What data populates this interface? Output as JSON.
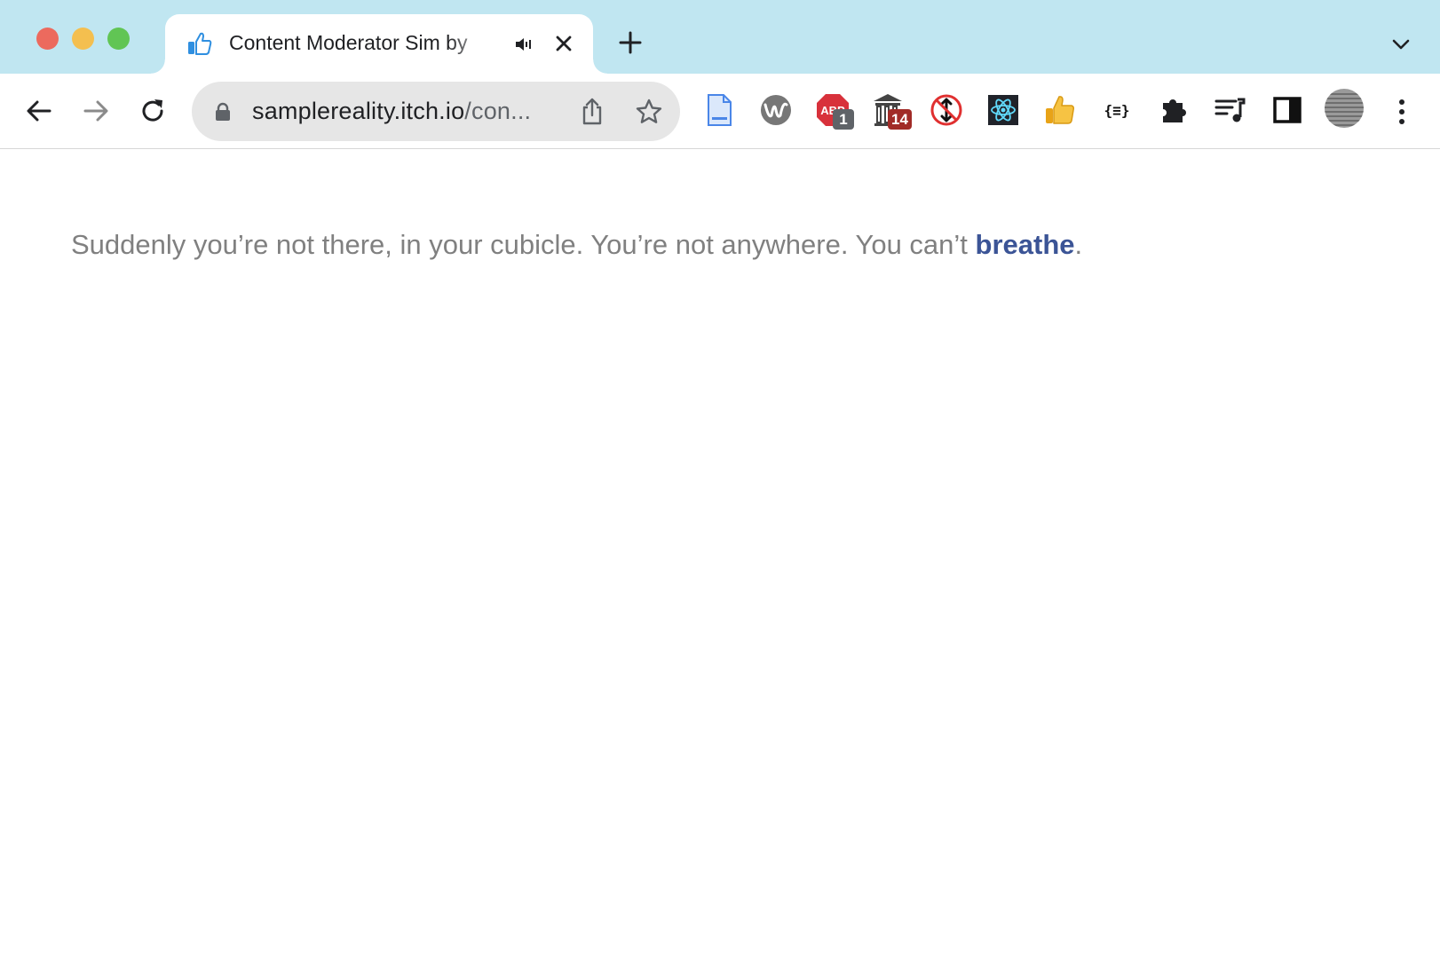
{
  "browser": {
    "tab": {
      "title": "Content Moderator Sim by",
      "favicon": "thumbs-up-icon",
      "audio": "speaker-icon"
    },
    "address_bar": {
      "host": "samplereality.itch.io",
      "path": "/con..."
    },
    "extensions": [
      {
        "name": "document-extension-icon"
      },
      {
        "name": "wave-extension-icon"
      },
      {
        "name": "adblock-plus-icon",
        "badge": "1"
      },
      {
        "name": "library-extension-icon",
        "badge": "14"
      },
      {
        "name": "no-scroll-extension-icon"
      },
      {
        "name": "react-devtools-icon"
      },
      {
        "name": "thumbs-up-extension-icon"
      },
      {
        "name": "json-viewer-icon"
      },
      {
        "name": "extensions-puzzle-icon"
      },
      {
        "name": "media-control-icon"
      },
      {
        "name": "side-panel-icon"
      },
      {
        "name": "profile-avatar"
      }
    ],
    "colors": {
      "tabstrip": "#c0e6f1",
      "link": "#3b5496",
      "text": "#808080"
    }
  },
  "page": {
    "text_before": "Suddenly you’re not there, in your cubicle. You’re not anywhere. You can’t ",
    "link": "breathe",
    "text_after": "."
  }
}
